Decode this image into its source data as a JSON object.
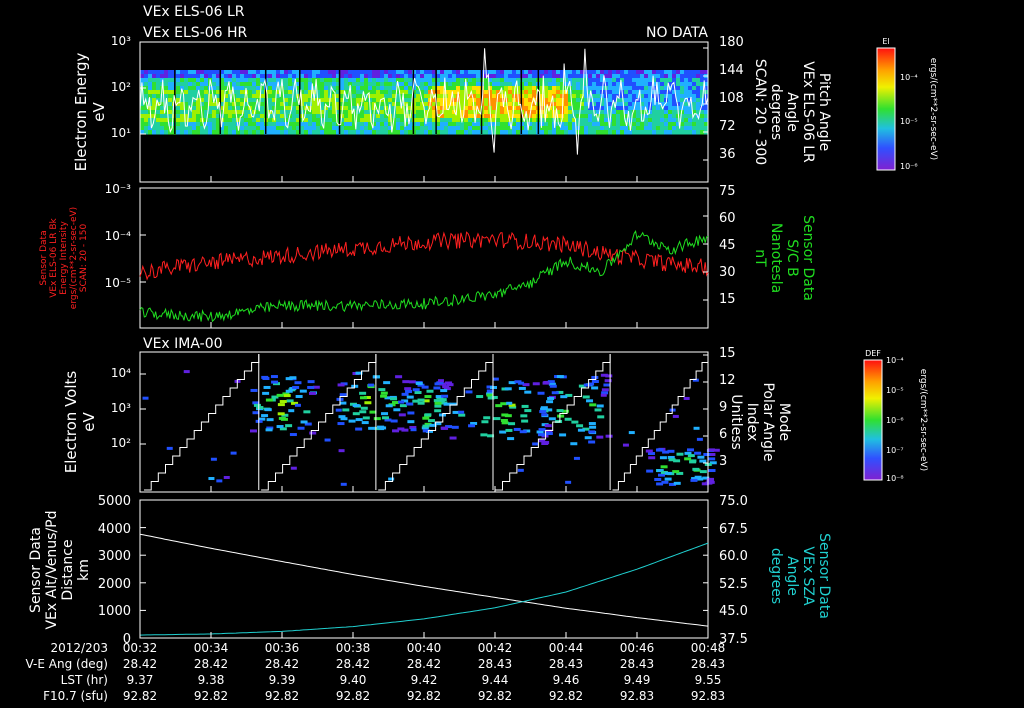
{
  "header": {
    "line1": "VEx ELS-06 LR",
    "line2": "VEx ELS-06 HR",
    "status": "NO DATA"
  },
  "panel1": {
    "ylabel": [
      "Electron Energy",
      "eV"
    ],
    "ytick_labels": [
      "10³",
      "10²",
      "10¹"
    ],
    "right_ticks": [
      "180",
      "144",
      "108",
      "72",
      "36"
    ],
    "right_label": [
      "Pitch Angle",
      "VEx ELS-06 LR",
      "Angle",
      "degrees",
      "SCAN: 20 - 300"
    ],
    "colorbar": {
      "title": "El",
      "tick_labels": [
        "10⁻⁴",
        "10⁻⁵",
        "10⁻⁶"
      ],
      "unit": "ergs/(cm**2-sr-sec-eV)"
    }
  },
  "panel2": {
    "left_label": [
      "Sensor Data",
      "VEx ELS-06 LR Bk",
      "Energy Intensity",
      "ergs/(cm**2-sr-sec-eV)",
      "SCAN: 20 - 150"
    ],
    "ytick_labels": [
      "10⁻³",
      "10⁻⁴",
      "10⁻⁵"
    ],
    "right_ticks": [
      "75",
      "60",
      "45",
      "30",
      "15"
    ],
    "right_label": [
      "Sensor Data",
      "S/C B",
      "Nanotesla",
      "nT"
    ]
  },
  "panel3": {
    "title": "VEx IMA-00",
    "ylabel": [
      "Electron Volts",
      "eV"
    ],
    "ytick_labels": [
      "10⁴",
      "10³",
      "10²"
    ],
    "right_ticks": [
      "15",
      "12",
      "9",
      "6",
      "3"
    ],
    "right_label": [
      "Mode",
      "Polar Angle",
      "Index",
      "Unitless"
    ],
    "colorbar": {
      "title": "DEF",
      "tick_labels": [
        "10⁻⁴",
        "10⁻⁵",
        "10⁻⁶",
        "10⁻⁷",
        "10⁻⁸"
      ],
      "unit": "ergs/(cm**2-sr-sec-eV)"
    }
  },
  "panel4": {
    "left_label": [
      "Sensor Data",
      "VEx Alt/Venus/Pd",
      "Distance",
      "km"
    ],
    "ytick_labels": [
      "5000",
      "4000",
      "3000",
      "2000",
      "1000",
      "0"
    ],
    "right_ticks": [
      "75.0",
      "67.5",
      "60.0",
      "52.5",
      "45.0",
      "37.5"
    ],
    "right_label": [
      "Sensor Data",
      "VEx SZA",
      "Angle",
      "degrees"
    ]
  },
  "footer": {
    "row_labels": [
      "2012/203",
      "V-E Ang (deg)",
      "LST (hr)",
      "F10.7 (sfu)"
    ],
    "times": [
      "00:32",
      "00:34",
      "00:36",
      "00:38",
      "00:40",
      "00:42",
      "00:44",
      "00:46",
      "00:48"
    ],
    "ve_ang": [
      "28.42",
      "28.42",
      "28.42",
      "28.42",
      "28.42",
      "28.43",
      "28.43",
      "28.43",
      "28.43"
    ],
    "lst": [
      "9.37",
      "9.38",
      "9.39",
      "9.40",
      "9.42",
      "9.44",
      "9.46",
      "9.49",
      "9.55"
    ],
    "f107": [
      "92.82",
      "92.82",
      "92.82",
      "92.82",
      "92.82",
      "92.82",
      "92.82",
      "92.83",
      "92.83"
    ]
  },
  "colors": {
    "red": "#ff2020",
    "green": "#20dd20",
    "cyan": "#20d0d0",
    "white": "#ffffff"
  },
  "chart_data": [
    {
      "type": "heatmap",
      "x_range": [
        "00:32",
        "00:48"
      ],
      "ylim": [
        1,
        1000
      ],
      "y_scale": "log",
      "description_series": "ELS electron energy spectrogram with pitch angle overlay (0-180 deg)"
    },
    {
      "type": "line",
      "x_minutes": [
        0,
        2,
        4,
        6,
        8,
        10,
        11,
        12,
        13,
        14,
        15,
        16
      ],
      "series": [
        {
          "name": "VEx ELS-06 LR Bk",
          "axis": "left",
          "y_scale": "log",
          "ylim": [
            1e-06,
            0.001
          ],
          "values": [
            1.5e-05,
            2.5e-05,
            3.5e-05,
            5e-05,
            7e-05,
            8e-05,
            7e-05,
            6e-05,
            4e-05,
            3e-05,
            2.3e-05,
            2e-05
          ]
        },
        {
          "name": "S/C B",
          "axis": "right",
          "ylim": [
            0,
            75
          ],
          "values": [
            8,
            6,
            12,
            12,
            13,
            18,
            24,
            36,
            30,
            50,
            42,
            49
          ]
        }
      ]
    },
    {
      "type": "heatmap",
      "x_range": [
        "00:32",
        "00:48"
      ],
      "ylim": [
        10,
        50000
      ],
      "y_scale": "log",
      "description_series": "IMA ion spectrogram with polar angle index overlay (0-15)"
    },
    {
      "type": "line",
      "x_minutes": [
        0,
        2,
        4,
        6,
        8,
        10,
        12,
        14,
        16
      ],
      "series": [
        {
          "name": "VEx Alt/Venus/Pd",
          "axis": "left",
          "ylim": [
            0,
            5000
          ],
          "values": [
            3760,
            3250,
            2770,
            2300,
            1870,
            1470,
            1080,
            740,
            430
          ]
        },
        {
          "name": "VEx SZA",
          "axis": "right",
          "ylim": [
            37.5,
            75.0
          ],
          "values": [
            38.3,
            38.6,
            39.3,
            40.6,
            42.7,
            45.7,
            50.0,
            56.2,
            63.3
          ]
        }
      ]
    }
  ]
}
